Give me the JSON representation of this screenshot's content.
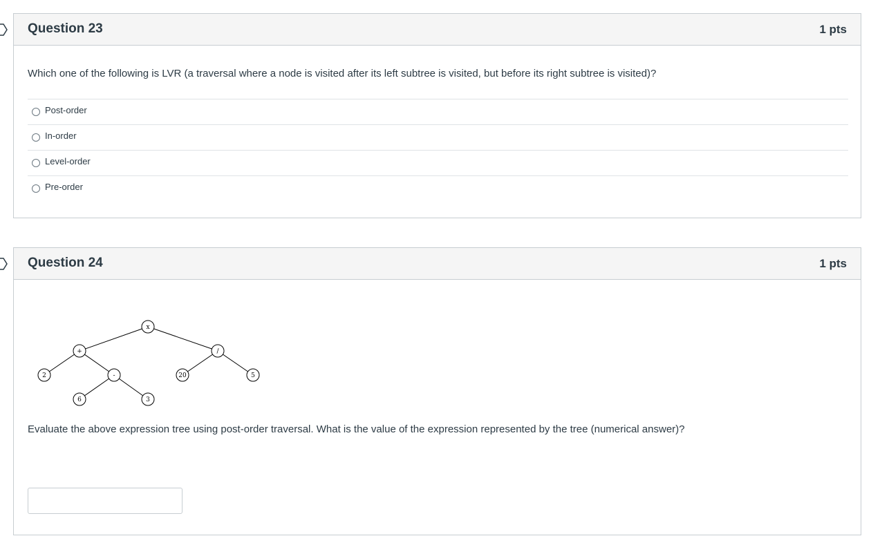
{
  "questions": {
    "q23": {
      "title": "Question 23",
      "points": "1 pts",
      "text": "Which one of the following is LVR (a traversal where a node is visited after its left subtree is visited, but before its right subtree is visited)?",
      "answers": [
        {
          "label": "Post-order",
          "selected": false
        },
        {
          "label": "In-order",
          "selected": false
        },
        {
          "label": "Level-order",
          "selected": false
        },
        {
          "label": "Pre-order",
          "selected": false
        }
      ]
    },
    "q24": {
      "title": "Question 24",
      "points": "1 pts",
      "text": "Evaluate the above expression tree using post-order traversal. What is the value of the expression represented by the tree (numerical answer)?",
      "answer_value": "",
      "answer_placeholder": "",
      "tree": {
        "nodes": [
          {
            "id": "root",
            "label": "x"
          },
          {
            "id": "plus",
            "label": "+"
          },
          {
            "id": "div",
            "label": "/"
          },
          {
            "id": "n2",
            "label": "2"
          },
          {
            "id": "minus",
            "label": "-"
          },
          {
            "id": "n20",
            "label": "20"
          },
          {
            "id": "n5",
            "label": "5"
          },
          {
            "id": "n6",
            "label": "6"
          },
          {
            "id": "n3",
            "label": "3"
          }
        ]
      }
    }
  },
  "colors": {
    "header_bg": "#f5f5f5",
    "border": "#c7cdd1",
    "text": "#2d3b45"
  }
}
